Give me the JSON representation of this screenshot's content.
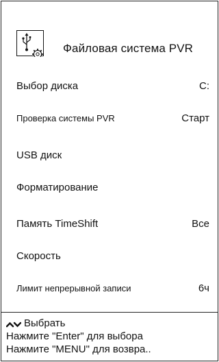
{
  "header": {
    "title": "Файловая система PVR",
    "icon": "usb-gear-icon"
  },
  "items": [
    {
      "label": "Выбор диска",
      "value": "C:"
    },
    {
      "label": "Проверка системы PVR",
      "value": "Старт"
    },
    {
      "label": "USB диск",
      "value": ""
    },
    {
      "label": "Форматирование",
      "value": ""
    },
    {
      "label": "Память TimeShift",
      "value": "Все"
    },
    {
      "label": "Скорость",
      "value": ""
    },
    {
      "label": "Лимит непрерывной записи",
      "value": "6ч"
    }
  ],
  "footer": {
    "select_hint": "Выбрать",
    "enter_hint": "Нажмите \"Enter\" для выбора",
    "menu_hint": "Нажмите \"MENU\" для возвра.."
  }
}
